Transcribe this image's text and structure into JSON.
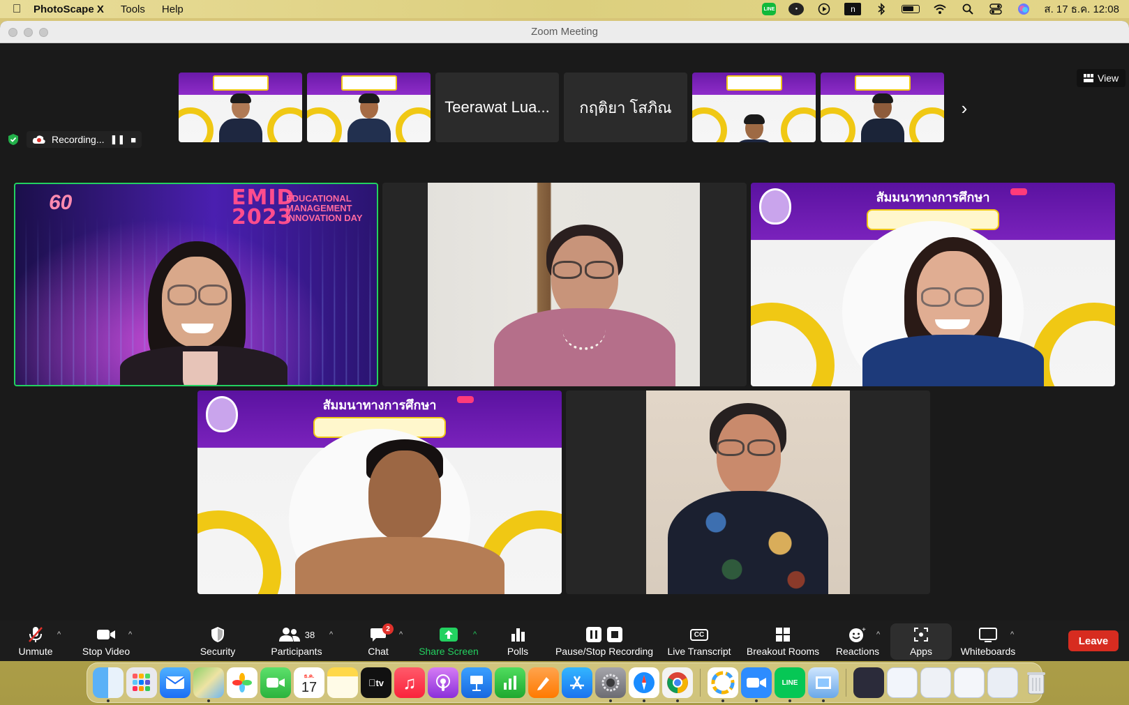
{
  "menubar": {
    "app_name": "PhotoScape X",
    "menus": [
      "Tools",
      "Help"
    ],
    "line_label": "LINE",
    "n_label": "n",
    "clock": "ส. 17 ธ.ค.  12:08"
  },
  "window": {
    "title": "Zoom Meeting"
  },
  "filmstrip": {
    "tiles": [
      {
        "kind": "poster"
      },
      {
        "kind": "poster"
      },
      {
        "kind": "name",
        "name": "Teerawat Lua..."
      },
      {
        "kind": "name",
        "name": "กฤติยา โสภิณ"
      },
      {
        "kind": "poster"
      },
      {
        "kind": "poster"
      }
    ],
    "view_label": "View"
  },
  "recording": {
    "label": "Recording..."
  },
  "gallery": {
    "emid_title": "EMID",
    "emid_year": "2023",
    "emid_subtitle_1": "EDUCATIONAL",
    "emid_subtitle_2": "MANAGEMENT",
    "emid_subtitle_3": "INNOVATION DAY",
    "emid_badge": "60",
    "poster_title": "สัมมนาทางการศึกษา"
  },
  "toolbar": {
    "unmute": "Unmute",
    "stop_video": "Stop Video",
    "security": "Security",
    "participants": "Participants",
    "participants_count": "38",
    "chat": "Chat",
    "chat_badge": "2",
    "share_screen": "Share Screen",
    "polls": "Polls",
    "pause_stop_recording": "Pause/Stop Recording",
    "live_transcript": "Live Transcript",
    "cc_label": "CC",
    "breakout_rooms": "Breakout Rooms",
    "reactions": "Reactions",
    "apps": "Apps",
    "whiteboards": "Whiteboards",
    "leave": "Leave"
  },
  "dock": {
    "calendar_month": "ธ.ค.",
    "calendar_day": "17",
    "tv_label": "tv",
    "line_label": "LINE",
    "icons": [
      "finder-icon",
      "launchpad-icon",
      "mail-icon",
      "maps-icon",
      "photos-icon",
      "facetime-icon",
      "calendar-icon",
      "notes-icon",
      "appletv-icon",
      "music-icon",
      "podcasts-icon",
      "keynote-icon",
      "numbers-icon",
      "pages-icon",
      "appstore-icon",
      "settings-icon",
      "safari-icon",
      "chrome-icon",
      "photoscape-icon",
      "zoom-icon",
      "line-icon",
      "preview-icon",
      "trash-icon"
    ]
  },
  "colors": {
    "active_speaker_border": "#23d160",
    "leave_red": "#d72c20",
    "share_green": "#23d160",
    "poster_purple": "#6a1aa8",
    "poster_yellow": "#f0c814"
  }
}
